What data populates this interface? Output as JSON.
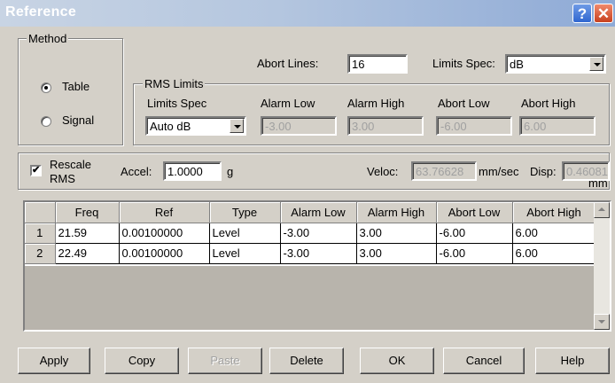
{
  "window": {
    "title": "Reference"
  },
  "method": {
    "legend": "Method",
    "options": [
      {
        "label": "Table",
        "selected": true
      },
      {
        "label": "Signal",
        "selected": false
      }
    ]
  },
  "abort_lines": {
    "label": "Abort Lines:",
    "value": "16"
  },
  "limits_spec_top": {
    "label": "Limits Spec:",
    "value": "dB"
  },
  "rms_limits": {
    "legend": "RMS Limits",
    "limits_spec_label": "Limits Spec",
    "limits_spec_value": "Auto dB",
    "alarm_low_label": "Alarm Low",
    "alarm_low_value": "-3.00",
    "alarm_high_label": "Alarm High",
    "alarm_high_value": "3.00",
    "abort_low_label": "Abort Low",
    "abort_low_value": "-6.00",
    "abort_high_label": "Abort High",
    "abort_high_value": "6.00"
  },
  "rescale": {
    "label_line1": "Rescale",
    "label_line2": "RMS",
    "checked": true,
    "check_glyph": "✔"
  },
  "accel": {
    "label": "Accel:",
    "value": "1.0000",
    "unit": "g"
  },
  "veloc": {
    "label": "Veloc:",
    "value": "63.76628",
    "unit": "mm/sec"
  },
  "disp": {
    "label": "Disp:",
    "value": "0.46081",
    "unit": "mm"
  },
  "table": {
    "columns": [
      "",
      "Freq",
      "Ref",
      "Type",
      "Alarm Low",
      "Alarm High",
      "Abort Low",
      "Abort High"
    ],
    "rows": [
      {
        "num": "1",
        "freq": "21.59",
        "ref": "0.00100000",
        "type": "Level",
        "alarm_low": "-3.00",
        "alarm_high": "3.00",
        "abort_low": "-6.00",
        "abort_high": "6.00"
      },
      {
        "num": "2",
        "freq": "22.49",
        "ref": "0.00100000",
        "type": "Level",
        "alarm_low": "-3.00",
        "alarm_high": "3.00",
        "abort_low": "-6.00",
        "abort_high": "6.00"
      }
    ]
  },
  "buttons": {
    "apply": "Apply",
    "copy": "Copy",
    "paste": "Paste",
    "delete": "Delete",
    "ok": "OK",
    "cancel": "Cancel",
    "help": "Help"
  },
  "colors": {
    "face": "#d4d0c8",
    "title_text": "#ffffff",
    "disabled_text": "#a0a0a0"
  },
  "icons": {
    "help": "?",
    "close": "✕"
  }
}
